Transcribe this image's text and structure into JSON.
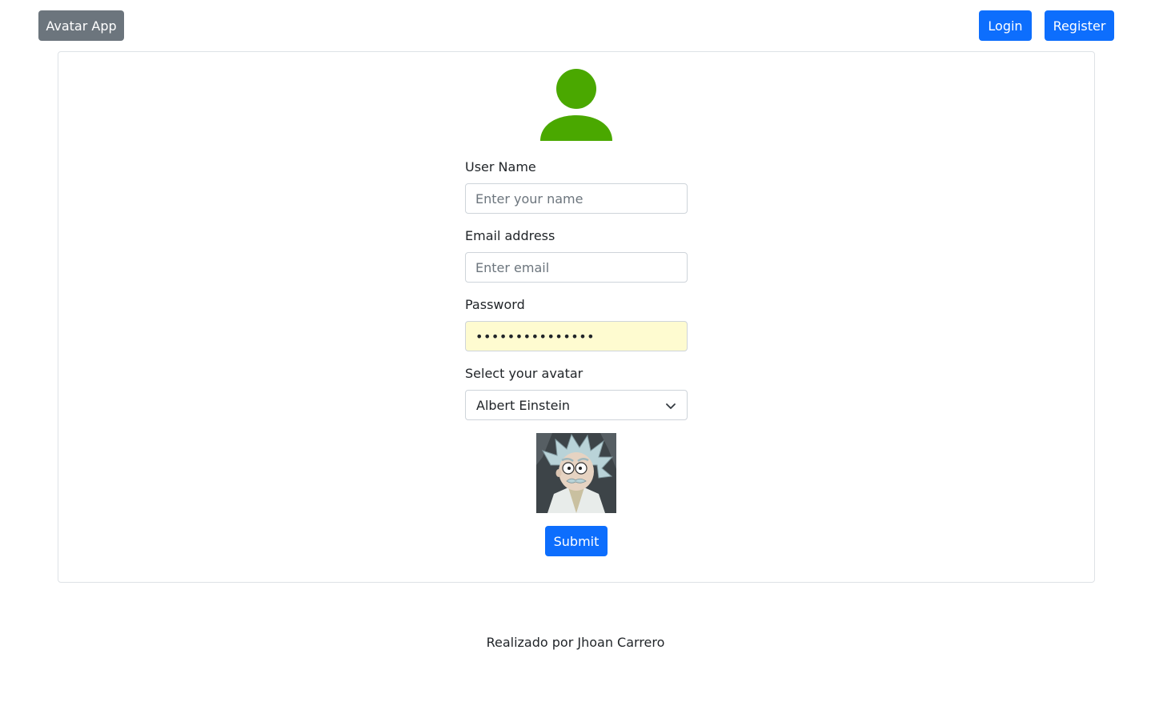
{
  "navbar": {
    "brand_label": "Avatar App",
    "login_label": "Login",
    "register_label": "Register"
  },
  "form": {
    "username": {
      "label": "User Name",
      "placeholder": "Enter your name",
      "value": ""
    },
    "email": {
      "label": "Email address",
      "placeholder": "Enter email",
      "value": ""
    },
    "password": {
      "label": "Password",
      "value": "•••••••••••••••"
    },
    "avatar": {
      "label": "Select your avatar",
      "selected": "Albert Einstein",
      "preview_alt": "Albert Einstein"
    },
    "submit_label": "Submit"
  },
  "footer": {
    "text": "Realizado por Jhoan Carrero"
  },
  "colors": {
    "primary": "#0d6efd",
    "secondary": "#6c757d",
    "user_icon": "#4aa800",
    "autofill": "#fefbd0"
  },
  "icons": [
    "user-icon",
    "chevron-down-icon"
  ]
}
